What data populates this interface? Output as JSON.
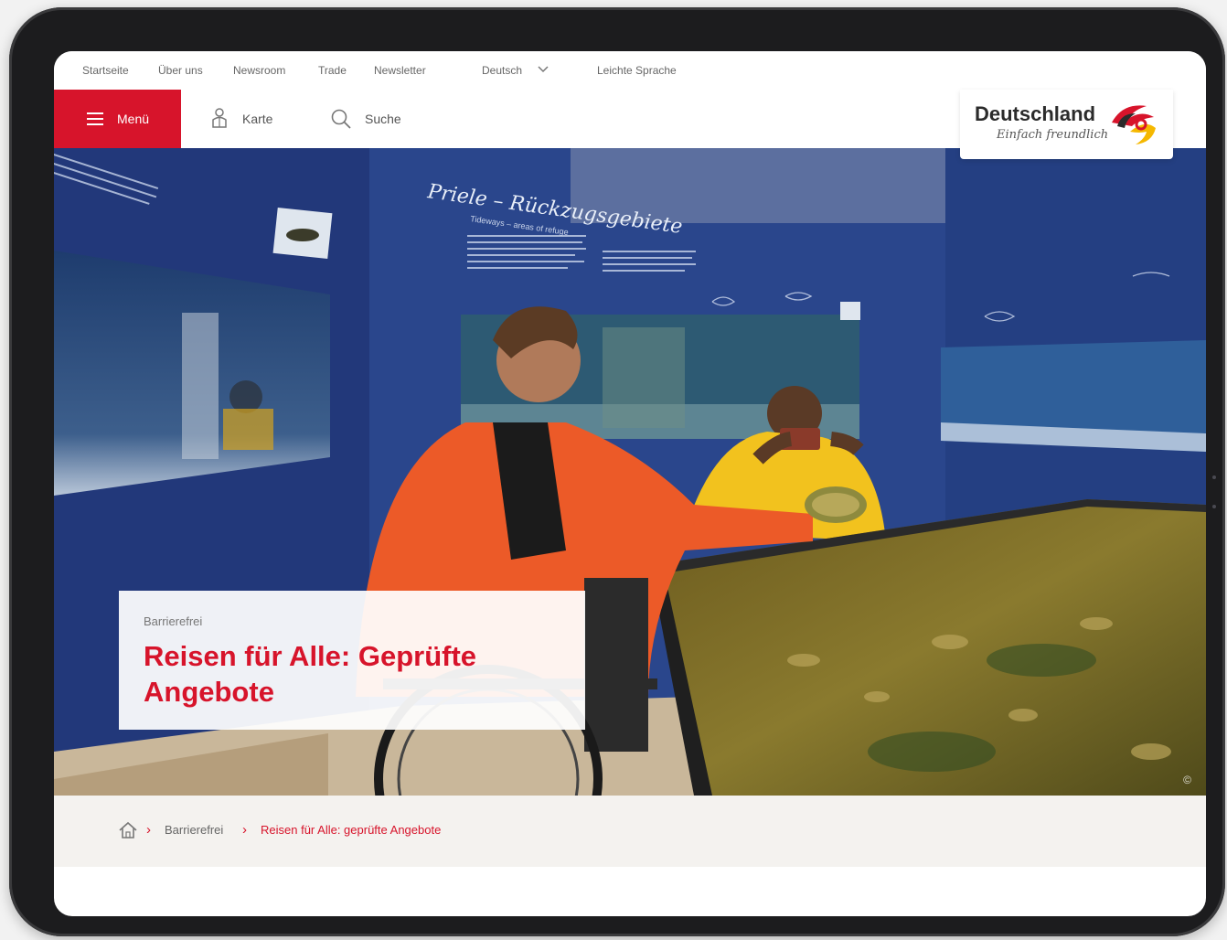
{
  "topnav": {
    "items": [
      "Startseite",
      "Über uns",
      "Newsroom",
      "Trade",
      "Newsletter"
    ],
    "language": "Deutsch",
    "easy_language": "Leichte Sprache"
  },
  "header": {
    "menu_label": "Menü",
    "map_label": "Karte",
    "search_label": "Suche"
  },
  "logo": {
    "title": "Deutschland",
    "subtitle": "Einfach freundlich"
  },
  "hero": {
    "kicker": "Barrierefrei",
    "title": "Reisen für Alle: Geprüfte Angebote",
    "copyright": "©",
    "wall_title": "Priele – Rückzugsgebiete",
    "wall_subtitle": "Tideways – areas of refuge"
  },
  "breadcrumb": {
    "separator": "›",
    "link": "Barrierefrei",
    "current": "Reisen für Alle: geprüfte Angebote"
  },
  "colors": {
    "brand_red": "#d7142b",
    "wall_blue": "#23397a",
    "breadcrumb_bg": "#f4f2ef"
  }
}
